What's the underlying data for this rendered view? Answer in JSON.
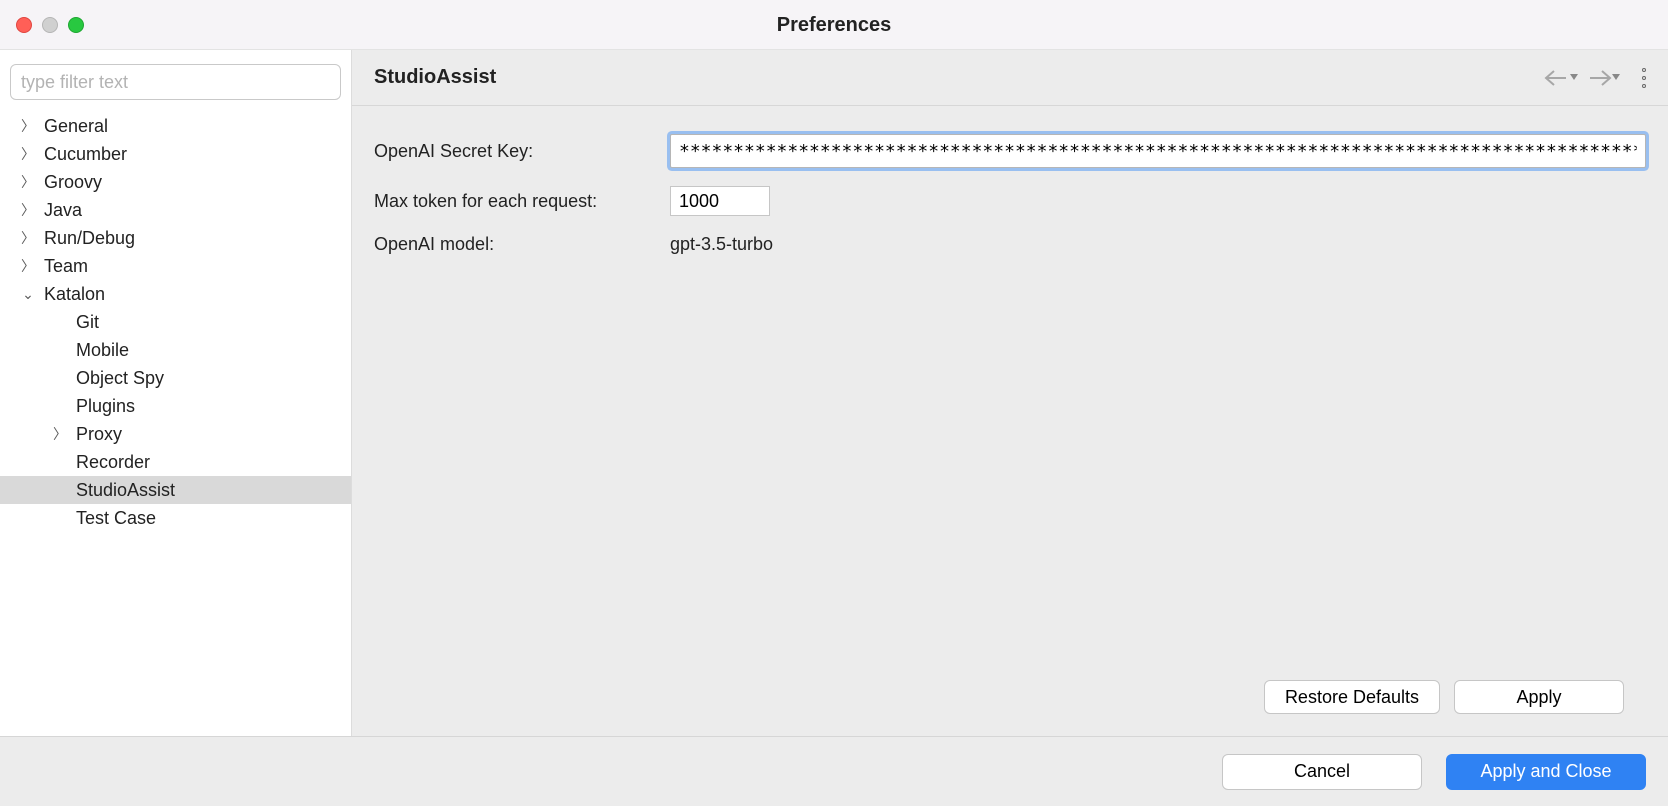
{
  "window": {
    "title": "Preferences"
  },
  "filter": {
    "placeholder": "type filter text"
  },
  "tree": {
    "items": [
      {
        "label": "General"
      },
      {
        "label": "Cucumber"
      },
      {
        "label": "Groovy"
      },
      {
        "label": "Java"
      },
      {
        "label": "Run/Debug"
      },
      {
        "label": "Team"
      },
      {
        "label": "Katalon"
      }
    ],
    "katalon_children": [
      {
        "label": "Git"
      },
      {
        "label": "Mobile"
      },
      {
        "label": "Object Spy"
      },
      {
        "label": "Plugins"
      },
      {
        "label": "Proxy"
      },
      {
        "label": "Recorder"
      },
      {
        "label": "StudioAssist"
      },
      {
        "label": "Test Case"
      }
    ]
  },
  "panel": {
    "title": "StudioAssist",
    "fields": {
      "secret_label": "OpenAI Secret Key:",
      "secret_value": "***********************************************************************************************",
      "max_token_label": "Max token for each request:",
      "max_token_value": "1000",
      "model_label": "OpenAI model:",
      "model_value": "gpt-3.5-turbo"
    },
    "buttons": {
      "restore": "Restore Defaults",
      "apply": "Apply"
    }
  },
  "footer": {
    "cancel": "Cancel",
    "apply_close": "Apply and Close"
  }
}
